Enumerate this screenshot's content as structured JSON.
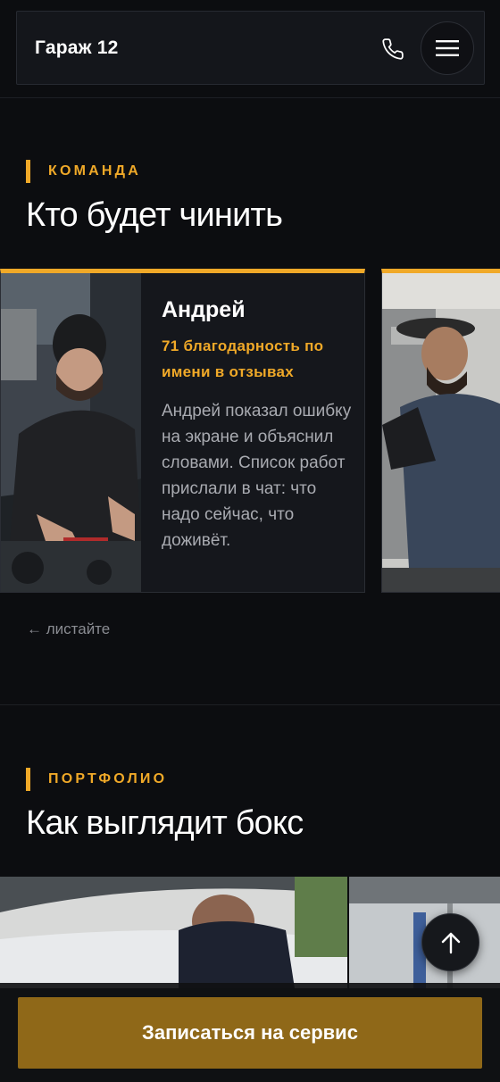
{
  "header": {
    "logo": "Гараж 12",
    "phone_icon": "phone-icon",
    "menu_icon": "hamburger-menu-icon"
  },
  "team": {
    "eyebrow": "КОМАНДА",
    "title": "Кто будет чинить",
    "cards": [
      {
        "name": "Андрей",
        "thanks": "71 благодарность по имени в отзывах",
        "description": "Андрей показал ошибку на экране и объяснил словами. Список работ прислали в чат: что надо сейчас, что доживёт."
      }
    ],
    "swipe_hint": "← листайте"
  },
  "portfolio": {
    "eyebrow": "ПОРТФОЛИО",
    "title": "Как выглядит бокс"
  },
  "scroll_top_icon": "arrow-up-icon",
  "cta": {
    "label": "Записаться на сервис"
  },
  "colors": {
    "background": "#0c0d10",
    "accent": "#f0a928",
    "cta": "#8f6818",
    "card": "#15171c"
  }
}
